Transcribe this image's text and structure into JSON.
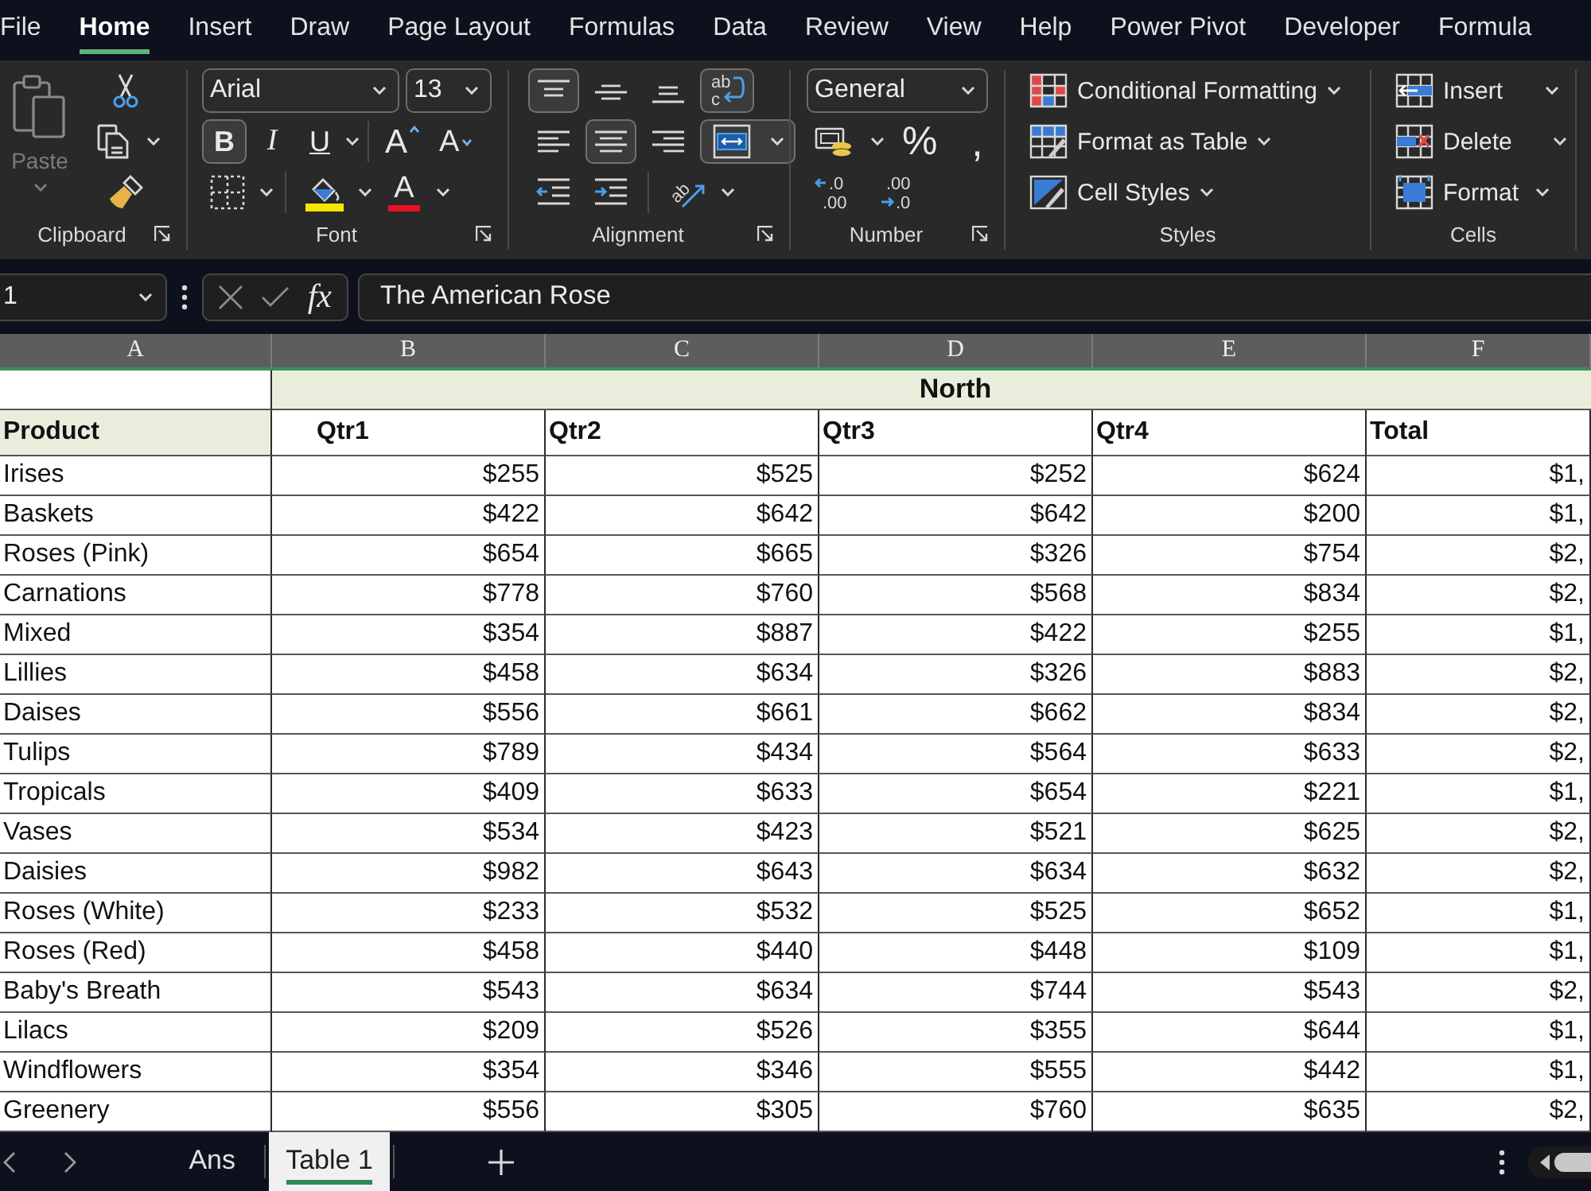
{
  "ribbon_tabs": [
    {
      "label": "File",
      "selected": false
    },
    {
      "label": "Home",
      "selected": true
    },
    {
      "label": "Insert",
      "selected": false
    },
    {
      "label": "Draw",
      "selected": false
    },
    {
      "label": "Page Layout",
      "selected": false
    },
    {
      "label": "Formulas",
      "selected": false
    },
    {
      "label": "Data",
      "selected": false
    },
    {
      "label": "Review",
      "selected": false
    },
    {
      "label": "View",
      "selected": false
    },
    {
      "label": "Help",
      "selected": false
    },
    {
      "label": "Power Pivot",
      "selected": false
    },
    {
      "label": "Developer",
      "selected": false
    },
    {
      "label": "Formula",
      "selected": false
    }
  ],
  "ribbon": {
    "clipboard": {
      "label": "Clipboard",
      "paste": {
        "label": "Paste",
        "disabled": true
      }
    },
    "font": {
      "label": "Font",
      "font_name": "Arial",
      "font_size": "13",
      "style_buttons": [
        {
          "kind": "bold",
          "glyph": "B",
          "on": true
        },
        {
          "kind": "italic",
          "glyph": "I",
          "on": false
        },
        {
          "kind": "underline",
          "glyph": "U",
          "on": false
        }
      ],
      "size_buttons": [
        {
          "kind": "grow",
          "glyph": "A"
        },
        {
          "kind": "shrink",
          "glyph": "A"
        }
      ],
      "font_color_glyph": "A"
    },
    "alignment": {
      "label": "Alignment",
      "vertical": [
        {
          "kind": "top",
          "on": true
        },
        {
          "kind": "middle",
          "on": false
        },
        {
          "kind": "bottom",
          "on": false
        }
      ],
      "wrap_text": {
        "glyph": "ab",
        "glyph_2": "c",
        "on": true
      },
      "horizontal": [
        {
          "kind": "left",
          "on": false
        },
        {
          "kind": "center",
          "on": true
        },
        {
          "kind": "right",
          "on": false
        }
      ],
      "merge_center": {
        "on": true
      },
      "orientation_glyph": "ab"
    },
    "number": {
      "label": "Number",
      "format": "General",
      "percent": "%",
      "comma": ",",
      "increase_decimal": [
        ".0",
        ".00"
      ],
      "decrease_decimal": [
        ".00",
        ".0"
      ]
    },
    "styles": {
      "label": "Styles",
      "items": [
        {
          "kind": "conditional",
          "label": "Conditional Formatting"
        },
        {
          "kind": "table",
          "label": "Format as Table"
        },
        {
          "kind": "cell_styles",
          "label": "Cell Styles"
        }
      ]
    },
    "cells": {
      "label": "Cells",
      "items": [
        {
          "kind": "insert",
          "label": "Insert"
        },
        {
          "kind": "delete",
          "label": "Delete"
        },
        {
          "kind": "format",
          "label": "Format"
        }
      ]
    }
  },
  "formula_bar": {
    "name_box": "1",
    "fx": "fx",
    "value": "The American Rose"
  },
  "sheet": {
    "columns": [
      "A",
      "B",
      "C",
      "D",
      "E",
      "F"
    ],
    "group_header": "North",
    "header": [
      {
        "text": "Product",
        "highlighted": true,
        "indent": false
      },
      {
        "text": "Qtr1",
        "highlighted": false,
        "indent": true
      },
      {
        "text": "Qtr2",
        "highlighted": false,
        "indent": false
      },
      {
        "text": "Qtr3",
        "highlighted": false,
        "indent": false
      },
      {
        "text": "Qtr4",
        "highlighted": false,
        "indent": false
      },
      {
        "text": "Total",
        "highlighted": false,
        "indent": false
      }
    ],
    "rows": [
      {
        "product": "Irises",
        "values": [
          "$255",
          "$525",
          "$252",
          "$624",
          "$1,"
        ]
      },
      {
        "product": "Baskets",
        "values": [
          "$422",
          "$642",
          "$642",
          "$200",
          "$1,"
        ]
      },
      {
        "product": "Roses (Pink)",
        "values": [
          "$654",
          "$665",
          "$326",
          "$754",
          "$2,"
        ]
      },
      {
        "product": "Carnations",
        "values": [
          "$778",
          "$760",
          "$568",
          "$834",
          "$2,"
        ]
      },
      {
        "product": "Mixed",
        "values": [
          "$354",
          "$887",
          "$422",
          "$255",
          "$1,"
        ]
      },
      {
        "product": "Lillies",
        "values": [
          "$458",
          "$634",
          "$326",
          "$883",
          "$2,"
        ]
      },
      {
        "product": "Daises",
        "values": [
          "$556",
          "$661",
          "$662",
          "$834",
          "$2,"
        ]
      },
      {
        "product": "Tulips",
        "values": [
          "$789",
          "$434",
          "$564",
          "$633",
          "$2,"
        ]
      },
      {
        "product": "Tropicals",
        "values": [
          "$409",
          "$633",
          "$654",
          "$221",
          "$1,"
        ]
      },
      {
        "product": "Vases",
        "values": [
          "$534",
          "$423",
          "$521",
          "$625",
          "$2,"
        ]
      },
      {
        "product": "Daisies",
        "values": [
          "$982",
          "$643",
          "$634",
          "$632",
          "$2,"
        ]
      },
      {
        "product": "Roses (White)",
        "values": [
          "$233",
          "$532",
          "$525",
          "$652",
          "$1,"
        ]
      },
      {
        "product": "Roses (Red)",
        "values": [
          "$458",
          "$440",
          "$448",
          "$109",
          "$1,"
        ]
      },
      {
        "product": "Baby's Breath",
        "values": [
          "$543",
          "$634",
          "$744",
          "$543",
          "$2,"
        ]
      },
      {
        "product": "Lilacs",
        "values": [
          "$209",
          "$526",
          "$355",
          "$644",
          "$1,"
        ]
      },
      {
        "product": "Windflowers",
        "values": [
          "$354",
          "$346",
          "$555",
          "$442",
          "$1,"
        ]
      },
      {
        "product": "Greenery",
        "values": [
          "$556",
          "$305",
          "$760",
          "$635",
          "$2,"
        ]
      }
    ]
  },
  "sheet_tabs": [
    {
      "label": "Ans",
      "selected": false
    },
    {
      "label": "Table 1",
      "selected": true
    }
  ]
}
